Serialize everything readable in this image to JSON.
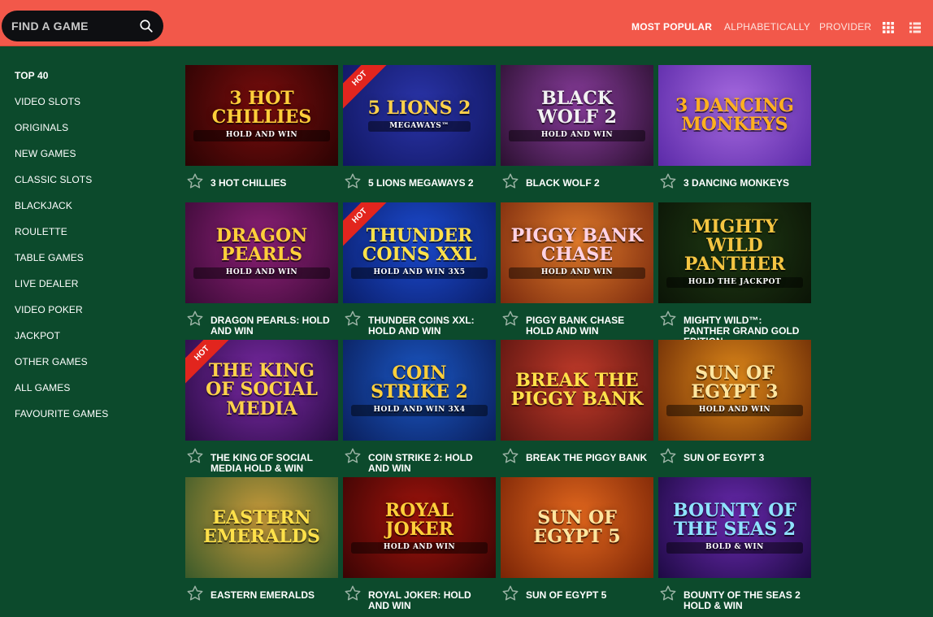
{
  "search": {
    "placeholder": "FIND A GAME",
    "value": ""
  },
  "sort": {
    "most_popular": "MOST POPULAR",
    "alphabetically": "ALPHABETICALLY",
    "provider": "PROVIDER",
    "active": "MOST POPULAR"
  },
  "sidebar": {
    "items": [
      {
        "label": "TOP 40",
        "active": true
      },
      {
        "label": "VIDEO SLOTS"
      },
      {
        "label": "ORIGINALS"
      },
      {
        "label": "NEW GAMES"
      },
      {
        "label": "CLASSIC SLOTS"
      },
      {
        "label": "BLACKJACK"
      },
      {
        "label": "ROULETTE"
      },
      {
        "label": "TABLE GAMES"
      },
      {
        "label": "LIVE DEALER"
      },
      {
        "label": "VIDEO POKER"
      },
      {
        "label": "JACKPOT"
      },
      {
        "label": "OTHER GAMES"
      },
      {
        "label": "ALL GAMES"
      },
      {
        "label": "FAVOURITE GAMES"
      }
    ]
  },
  "hot_label": "HOT",
  "games": [
    {
      "title": "3 HOT CHILLIES",
      "art": "3 HOT CHILLIES",
      "sub": "HOLD AND WIN",
      "hot": false,
      "bg": "#7a0d0d",
      "bg2": "#2a0303",
      "fg": "#ffcf3a"
    },
    {
      "title": "5 LIONS MEGAWAYS 2",
      "art": "5 LIONS 2",
      "sub": "MEGAWAYS™",
      "hot": true,
      "bg": "#2a34a8",
      "bg2": "#101660",
      "fg": "#ffd24a"
    },
    {
      "title": "BLACK WOLF 2",
      "art": "BLACK WOLF 2",
      "sub": "HOLD AND WIN",
      "hot": false,
      "bg": "#8a3d9e",
      "bg2": "#2b1030",
      "fg": "#f2f2f2"
    },
    {
      "title": "3 DANCING MONKEYS",
      "art": "3 DANCING MONKEYS",
      "sub": "",
      "hot": false,
      "bg": "#a76ae0",
      "bg2": "#5b2aa8",
      "fg": "#ffb020"
    },
    {
      "title": "DRAGON PEARLS: HOLD AND WIN",
      "art": "DRAGON PEARLS",
      "sub": "HOLD AND WIN",
      "hot": false,
      "bg": "#8e2178",
      "bg2": "#3a0a36",
      "fg": "#ffcf3a"
    },
    {
      "title": "THUNDER COINS XXL: HOLD AND WIN",
      "art": "THUNDER COINS XXL",
      "sub": "HOLD AND WIN 3X5",
      "hot": true,
      "bg": "#1c4bd0",
      "bg2": "#0a1e6a",
      "fg": "#ffe14a"
    },
    {
      "title": "PIGGY BANK CHASE HOLD AND WIN",
      "art": "PIGGY BANK CHASE",
      "sub": "HOLD AND WIN",
      "hot": false,
      "bg": "#e07a2a",
      "bg2": "#7a2a0e",
      "fg": "#ffd2e4"
    },
    {
      "title": "MIGHTY WILD™: PANTHER GRAND GOLD EDITION",
      "art": "MIGHTY WILD PANTHER",
      "sub": "HOLD THE JACKPOT",
      "hot": false,
      "bg": "#1f3a14",
      "bg2": "#0b1406",
      "fg": "#f5c542"
    },
    {
      "title": "THE KING OF SOCIAL MEDIA HOLD & WIN",
      "art": "THE KING OF SOCIAL MEDIA",
      "sub": "",
      "hot": true,
      "bg": "#7b2aa6",
      "bg2": "#2a0c44",
      "fg": "#ffd24a"
    },
    {
      "title": "COIN STRIKE 2: HOLD AND WIN",
      "art": "COIN STRIKE 2",
      "sub": "HOLD AND WIN 3X4",
      "hot": false,
      "bg": "#1b57c4",
      "bg2": "#0a1f5c",
      "fg": "#ffcf3a"
    },
    {
      "title": "BREAK THE PIGGY BANK",
      "art": "BREAK THE PIGGY BANK",
      "sub": "",
      "hot": false,
      "bg": "#c23b2a",
      "bg2": "#5a1410",
      "fg": "#ffe14a"
    },
    {
      "title": "SUN OF EGYPT 3",
      "art": "SUN OF EGYPT 3",
      "sub": "HOLD AND WIN",
      "hot": false,
      "bg": "#e08a1a",
      "bg2": "#6a2a06",
      "fg": "#ffe6a0"
    },
    {
      "title": "EASTERN EMERALDS",
      "art": "EASTERN EMERALDS",
      "sub": "",
      "hot": false,
      "bg": "#c89a3a",
      "bg2": "#3a5a2a",
      "fg": "#ffe14a"
    },
    {
      "title": "ROYAL JOKER: HOLD AND WIN",
      "art": "ROYAL JOKER",
      "sub": "HOLD AND WIN",
      "hot": false,
      "bg": "#a1140c",
      "bg2": "#3a0404",
      "fg": "#ffcf3a"
    },
    {
      "title": "SUN OF EGYPT 5",
      "art": "SUN OF EGYPT 5",
      "sub": "",
      "hot": false,
      "bg": "#e3681e",
      "bg2": "#7a2406",
      "fg": "#ffe6a0"
    },
    {
      "title": "BOUNTY OF THE SEAS 2 HOLD & WIN",
      "art": "BOUNTY OF THE SEAS 2",
      "sub": "BOLD & WIN",
      "hot": false,
      "bg": "#6a2ab0",
      "bg2": "#1e0a44",
      "fg": "#8fe3ff"
    }
  ],
  "colors": {
    "topbar": "#f2584a",
    "background": "#0c4a2c",
    "hot": "#e2251e"
  }
}
